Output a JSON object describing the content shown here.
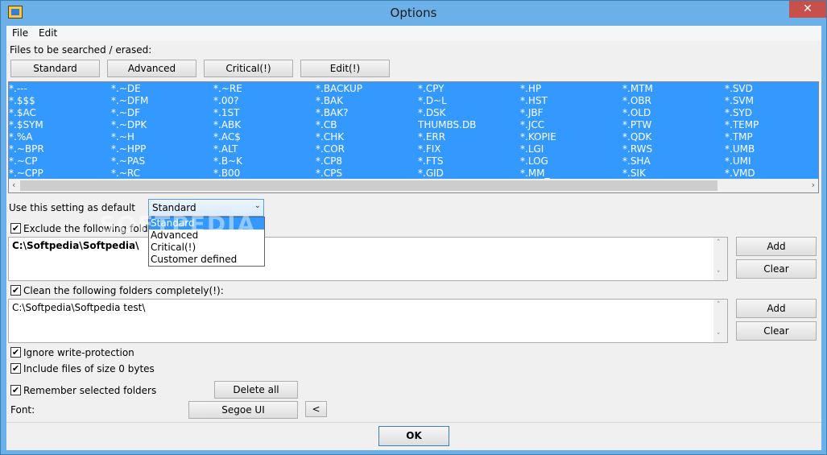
{
  "window": {
    "title": "Options",
    "close_glyph": "✕",
    "icon": "app-icon"
  },
  "menu": {
    "file": "File",
    "edit": "Edit"
  },
  "files_section": {
    "label": "Files to be searched / erased:",
    "buttons": [
      "Standard",
      "Advanced",
      "Critical(!)",
      "Edit(!)"
    ]
  },
  "patterns": {
    "columns": [
      [
        "*.---",
        "*.$$$",
        "*.$AC",
        "*.$SYM",
        "*.%A",
        "*.~BPR",
        "*.~CP",
        "*.~CPP"
      ],
      [
        "*.~DE",
        "*.~DFM",
        "*.~DF",
        "*.~DPK",
        "*.~H",
        "*.~HPP",
        "*.~PAS",
        "*.~RC"
      ],
      [
        "*.~RE",
        "*.00?",
        "*.1ST",
        "*.ABK",
        "*.AC$",
        "*.ALT",
        "*.B~K",
        "*.B00"
      ],
      [
        "*.BACKUP",
        "*.BAK",
        "*.BAK?",
        "*.CB",
        "*.CHK",
        "*.COR",
        "*.CP8",
        "*.CPS"
      ],
      [
        "*.CPY",
        "*.D~L",
        "*.DSK",
        "THUMBS.DB",
        "*.ERR",
        "*.FIX",
        "*.FTS",
        "*.GID"
      ],
      [
        "*.HP",
        "*.HST",
        "*.JBF",
        "*.JCC",
        "*.KOPIE",
        "*.LGI",
        "*.LOG",
        "*.MM_"
      ],
      [
        "*.MTM",
        "*.OBR",
        "*.OLD",
        "*.PTW",
        "*.QDK",
        "*.RWS",
        "*.SHA",
        "*.SIK"
      ],
      [
        "*.SVD",
        "*.SVM",
        "*.SYD",
        "*.TEMP",
        "*.TMP",
        "*.UMB",
        "*.UMI",
        "*.VMD"
      ]
    ],
    "selection_color": "#3399ff"
  },
  "default_setting": {
    "label": "Use this setting as default",
    "selected": "Standard",
    "options": [
      "Standard",
      "Advanced",
      "Critical(!)",
      "Customer defined"
    ]
  },
  "exclude": {
    "label": "Exclude the following folders:",
    "checked": true,
    "content": "C:\\Softpedia\\Softpedia\\",
    "add_label": "Add",
    "clear_label": "Clear"
  },
  "clean": {
    "label": "Clean the following folders completely(!):",
    "checked": true,
    "content": "C:\\Softpedia\\Softpedia test\\",
    "add_label": "Add",
    "clear_label": "Clear"
  },
  "options": {
    "ignore_write": {
      "label": "Ignore write-protection",
      "checked": true
    },
    "include_zero": {
      "label": "Include files of size 0 bytes",
      "checked": true
    },
    "remember": {
      "label": "Remember selected folders",
      "checked": true
    }
  },
  "delete_all_label": "Delete all",
  "font": {
    "label": "Font:",
    "value": "Segoe UI",
    "button": "<"
  },
  "ok_label": "OK",
  "watermark": "SOFTPEDIA",
  "check_glyph": "✔",
  "arrows": {
    "left": "‹",
    "right": "›",
    "up": "˄",
    "down": "˅",
    "combo": "⌄"
  }
}
